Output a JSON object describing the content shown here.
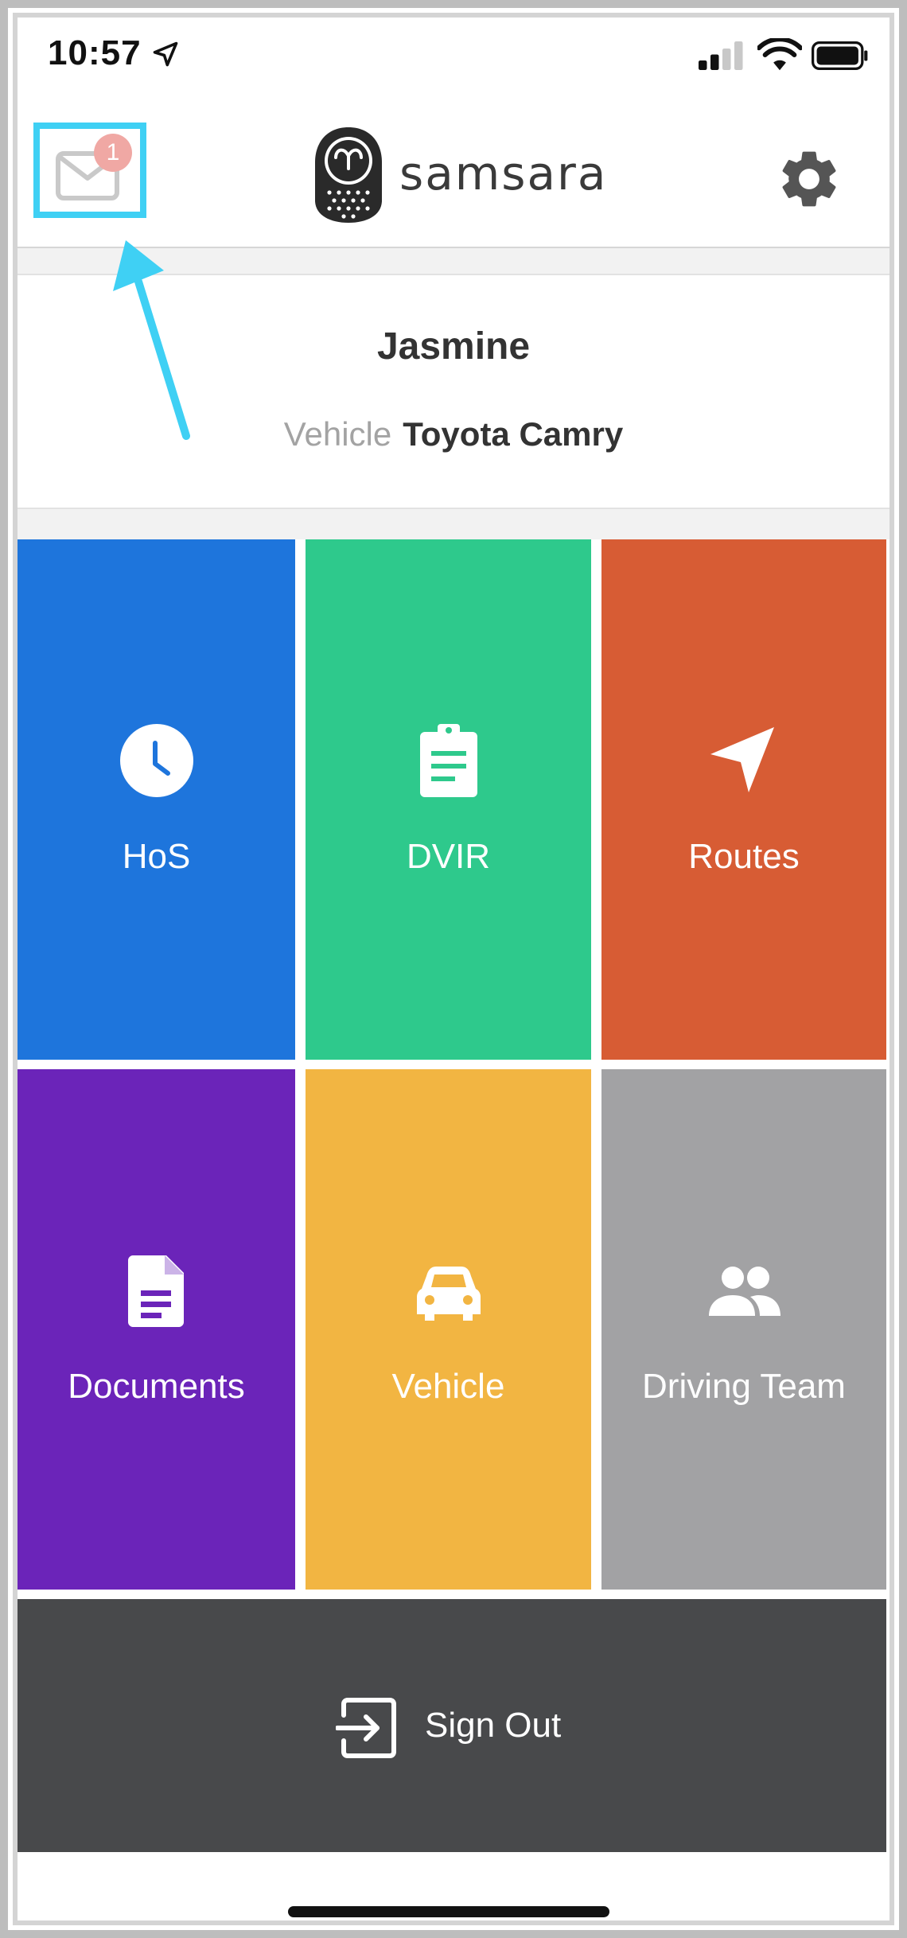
{
  "status_bar": {
    "time": "10:57"
  },
  "header": {
    "mail_badge": "1",
    "logo_text": "samsara",
    "mail_icon": "mail-icon",
    "settings_icon": "gear-icon"
  },
  "driver": {
    "name": "Jasmine",
    "vehicle_label": "Vehicle",
    "vehicle_value": "Toyota Camry"
  },
  "tiles": [
    {
      "label": "HoS",
      "icon": "clock-icon",
      "color": "#1e75dc"
    },
    {
      "label": "DVIR",
      "icon": "clipboard-icon",
      "color": "#2ec98c"
    },
    {
      "label": "Routes",
      "icon": "navigation-icon",
      "color": "#d75c34"
    },
    {
      "label": "Documents",
      "icon": "document-icon",
      "color": "#6b24b9"
    },
    {
      "label": "Vehicle",
      "icon": "car-icon",
      "color": "#f2b542"
    },
    {
      "label": "Driving Team",
      "icon": "people-icon",
      "color": "#a2a2a4"
    }
  ],
  "sign_out": {
    "label": "Sign Out",
    "icon": "sign-out-icon",
    "color": "#48494b"
  },
  "annotation": {
    "highlight_color": "#3fd0f4"
  }
}
